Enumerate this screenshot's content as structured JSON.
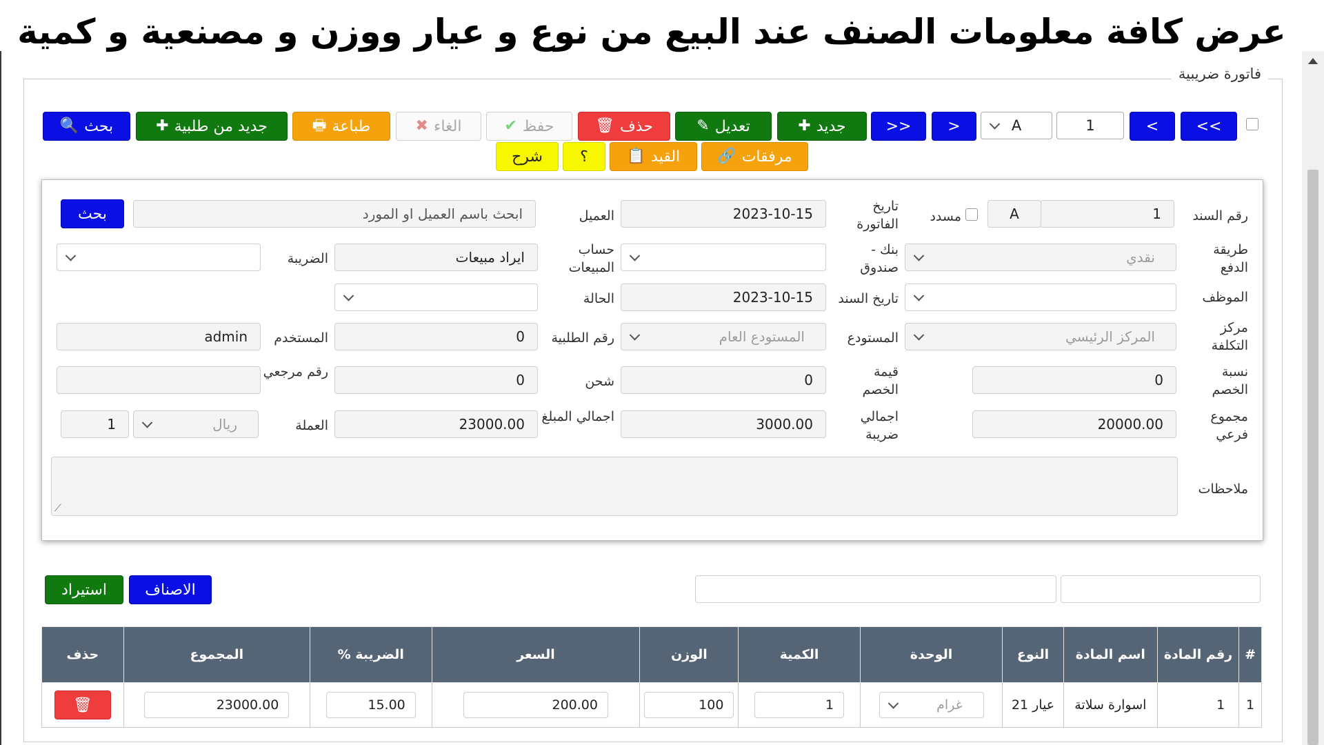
{
  "banner": "عرض كافة معلومات الصنف عند البيع من نوع و عيار ووزن و مصنعية و كمية",
  "legend": "فاتورة ضريبية",
  "toolbar": {
    "last": ">>",
    "next": ">",
    "record_number": "1",
    "series": "A",
    "prev": "<",
    "first": "<<",
    "new": "جديد",
    "edit": "تعديل",
    "delete": "حذف",
    "save": "حفظ",
    "cancel": "الغاء",
    "print": "طباعة",
    "new_from_order": "جديد من طلبية",
    "search": "بحث",
    "attachments": "مرفقات",
    "entry": "القيد",
    "help": "؟",
    "explain": "شرح"
  },
  "form": {
    "doc_no_label": "رقم السند",
    "doc_no": "1",
    "doc_series": "A",
    "paid_label": "مسدد",
    "invoice_date_label": "تاريخ الفاتورة",
    "invoice_date": "2023-10-15",
    "customer_label": "العميل",
    "customer_placeholder": "ابحث باسم العميل او المورد",
    "search_button": "بحث",
    "payment_method_label": "طريقة الدفع",
    "payment_method": "نقدي",
    "bank_box_label": "بنك - صندوق",
    "sales_account_label": "حساب المبيعات",
    "sales_account": "ايراد مبيعات",
    "tax_label": "الضريبة",
    "employee_label": "الموظف",
    "doc_date_label": "تاريخ السند",
    "doc_date": "2023-10-15",
    "status_label": "الحالة",
    "cost_center_label": "مركز التكلفة",
    "cost_center": "المركز الرئيسي",
    "warehouse_label": "المستودع",
    "warehouse": "المستودع العام",
    "order_no_label": "رقم الطلبية",
    "order_no": "0",
    "user_label": "المستخدم",
    "user": "admin",
    "discount_rate_label": "نسبة الخصم",
    "discount_rate": "0",
    "discount_value_label": "قيمة الخصم",
    "discount_value": "0",
    "shipping_label": "شحن",
    "shipping": "0",
    "reference_label": "رقم مرجعي",
    "subtotal_label": "مجموع فرعي",
    "subtotal": "20000.00",
    "total_tax_label": "اجمالي ضريبة",
    "total_tax": "3000.00",
    "total_amount_label": "اجمالي المبلغ",
    "total_amount": "23000.00",
    "currency_label": "العملة",
    "currency": "ريال",
    "exchange_rate": "1",
    "notes_label": "ملاحظات"
  },
  "actions": {
    "items": "الاصناف",
    "import": "استيراد"
  },
  "table": {
    "headers": [
      "#",
      "رقم المادة",
      "اسم المادة",
      "النوع",
      "الوحدة",
      "الكمية",
      "الوزن",
      "السعر",
      "الضريبة %",
      "المجموع",
      "حذف"
    ],
    "rows": [
      {
        "idx": "1",
        "item_no": "1",
        "item_name": "اسوارة سلاتة",
        "type": "عيار 21",
        "unit": "غرام",
        "qty": "1",
        "weight": "100",
        "price": "200.00",
        "tax": "15.00",
        "total": "23000.00"
      }
    ]
  }
}
